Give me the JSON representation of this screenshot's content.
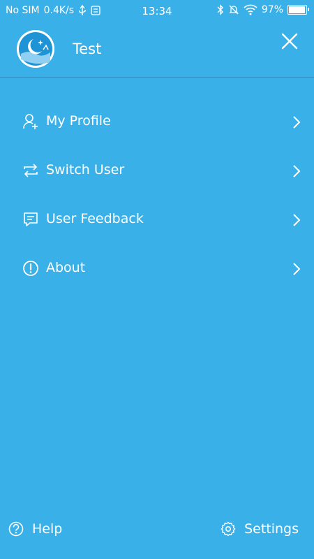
{
  "status_bar": {
    "carrier": "No SIM",
    "speed": "0.4K/s",
    "time": "13:34",
    "battery": "97%"
  },
  "header": {
    "user_name": "Test"
  },
  "menu": {
    "items": [
      {
        "label": "My Profile",
        "icon": "user-add-icon"
      },
      {
        "label": "Switch User",
        "icon": "switch-icon"
      },
      {
        "label": "User Feedback",
        "icon": "feedback-icon"
      },
      {
        "label": "About",
        "icon": "info-icon"
      }
    ]
  },
  "footer": {
    "help_label": "Help",
    "settings_label": "Settings"
  },
  "colors": {
    "background": "#3ab0e8",
    "divider": "#2f8fc4",
    "text": "#ffffff"
  }
}
